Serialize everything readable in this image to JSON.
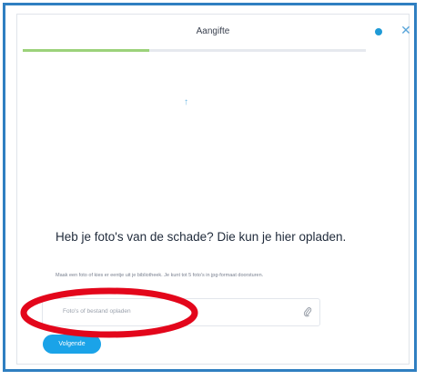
{
  "header": {
    "title": "Aangifte",
    "close_symbol": "✕"
  },
  "progress": {
    "fraction": 0.37
  },
  "content": {
    "upload_arrow": "↑",
    "heading": "Heb je foto's van de schade? Die kun je hier opladen.",
    "helper_text": "Maak een foto of kies er eentje uit je bibliotheek. Je kunt tot 5 foto's in jpg-formaat doorsturen.",
    "upload_placeholder": "Foto's of bestand opladen"
  },
  "actions": {
    "next_label": "Volgende"
  },
  "colors": {
    "frame_border": "#2f7fc1",
    "progress": "#9cd27a",
    "primary_button": "#1aa3e8",
    "highlight_ellipse": "#e3061b"
  },
  "icons": {
    "close": "close-icon",
    "attachment": "paperclip-icon",
    "upload": "upload-arrow-icon"
  }
}
